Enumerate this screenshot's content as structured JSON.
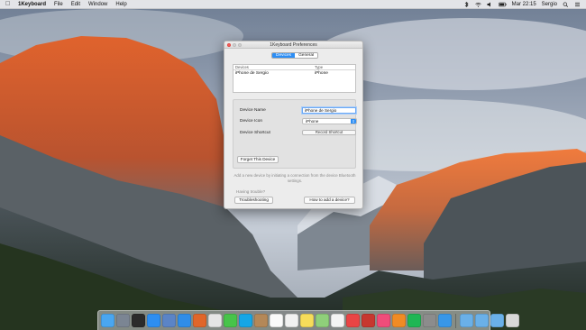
{
  "menubar": {
    "app_name": "1Keyboard",
    "menus": [
      "File",
      "Edit",
      "Window",
      "Help"
    ],
    "clock": "Mar 22:15",
    "user": "Sergio"
  },
  "window": {
    "title": "1Keyboard Preferences",
    "tabs": [
      {
        "label": "Devices",
        "active": true
      },
      {
        "label": "General",
        "active": false
      }
    ],
    "devices_table": {
      "columns": [
        "Devices",
        "Type"
      ],
      "rows": [
        {
          "name": "iPhone de Sergio",
          "type": "iPhone"
        }
      ]
    },
    "device_name_label": "Device Name",
    "device_name_value": "iPhone de Sergio",
    "device_icon_label": "Device Icon",
    "device_icon_value": "iPhone",
    "device_shortcut_label": "Device Shortcut",
    "record_shortcut_button": "Record Shortcut",
    "forget_button": "Forget This Device",
    "hint": "Add a new device by initiating a connection from the device Bluetooth settings.",
    "trouble_label": "Having trouble?",
    "troubleshooting_button": "Troubleshooting",
    "howto_button": "How to add a device?"
  },
  "colors": {
    "accent": "#2c8ef5",
    "close_light": "#fc605c"
  },
  "dock": {
    "apps": [
      {
        "icon": "finder-icon",
        "color": "#4aa6f0"
      },
      {
        "icon": "launchpad-icon",
        "color": "#7b8593"
      },
      {
        "icon": "mission-control-icon",
        "color": "#2b2b2b"
      },
      {
        "icon": "app-store-icon",
        "color": "#2d8ef1"
      },
      {
        "icon": "preview-icon",
        "color": "#5b84c6"
      },
      {
        "icon": "safari-icon",
        "color": "#2f8de8"
      },
      {
        "icon": "firefox-icon",
        "color": "#e0662a"
      },
      {
        "icon": "chrome-icon",
        "color": "#e6e6e6"
      },
      {
        "icon": "messages-icon",
        "color": "#47c44a"
      },
      {
        "icon": "skype-icon",
        "color": "#15a6e6"
      },
      {
        "icon": "contacts-icon",
        "color": "#b48858"
      },
      {
        "icon": "calendar-icon",
        "color": "#fafafa"
      },
      {
        "icon": "reminders-icon",
        "color": "#f1f1f1"
      },
      {
        "icon": "notes-icon",
        "color": "#f6dc5a"
      },
      {
        "icon": "maps-icon",
        "color": "#8fcf7a"
      },
      {
        "icon": "photos-icon",
        "color": "#f4f4f4"
      },
      {
        "icon": "news-icon",
        "color": "#e94444"
      },
      {
        "icon": "photo-booth-icon",
        "color": "#c7372f"
      },
      {
        "icon": "itunes-icon",
        "color": "#f04c7a"
      },
      {
        "icon": "ibooks-icon",
        "color": "#f08b24"
      },
      {
        "icon": "spotify-icon",
        "color": "#1fb754"
      },
      {
        "icon": "system-preferences-icon",
        "color": "#8c8c8c"
      },
      {
        "icon": "1keyboard-icon",
        "color": "#3897e8"
      }
    ],
    "folders": [
      {
        "icon": "applications-folder-icon",
        "color": "#6ab0e8"
      },
      {
        "icon": "documents-folder-icon",
        "color": "#6ab0e8"
      },
      {
        "icon": "downloads-folder-icon",
        "color": "#6ab0e8"
      },
      {
        "icon": "trash-icon",
        "color": "#d8d8d8"
      }
    ]
  }
}
